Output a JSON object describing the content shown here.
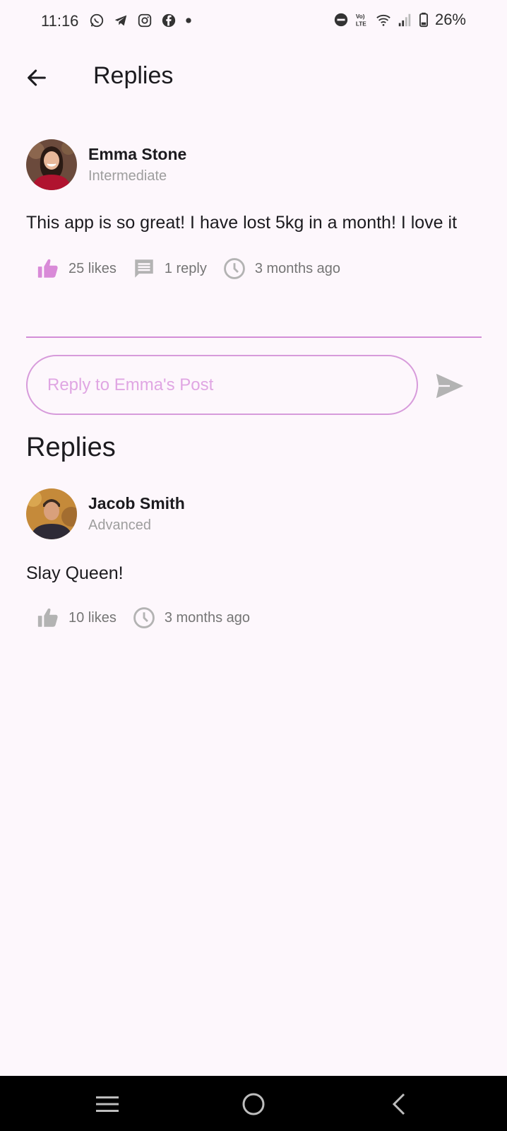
{
  "status_bar": {
    "time": "11:16",
    "battery": "26%",
    "left_icons": [
      "whatsapp-icon",
      "telegram-icon",
      "instagram-icon",
      "facebook-icon",
      "dot-icon"
    ],
    "right_icons": [
      "dnd-icon",
      "volte-icon",
      "wifi-icon",
      "signal-icon",
      "battery-icon"
    ]
  },
  "app_bar": {
    "title": "Replies",
    "back_icon": "arrow-left-icon"
  },
  "post": {
    "author": "Emma Stone",
    "level": "Intermediate",
    "text": "This app is so great! I have lost 5kg in a month! I love it",
    "likes": "25 likes",
    "replies": "1 reply",
    "time": "3 months ago",
    "liked": true
  },
  "reply_box": {
    "placeholder": "Reply to Emma's Post",
    "send_icon": "send-icon"
  },
  "replies_section": {
    "heading": "Replies",
    "items": [
      {
        "author": "Jacob Smith",
        "level": "Advanced",
        "text": "Slay Queen!",
        "likes": "10 likes",
        "time": "3 months ago",
        "liked": false
      }
    ]
  },
  "colors": {
    "accent": "#d38ed8",
    "liked_icon": "#d98ad8",
    "muted_icon": "#b3b3b3",
    "background": "#fdf7fc"
  },
  "nav_bar": {
    "icons": [
      "recents-icon",
      "home-icon",
      "back-icon"
    ]
  }
}
